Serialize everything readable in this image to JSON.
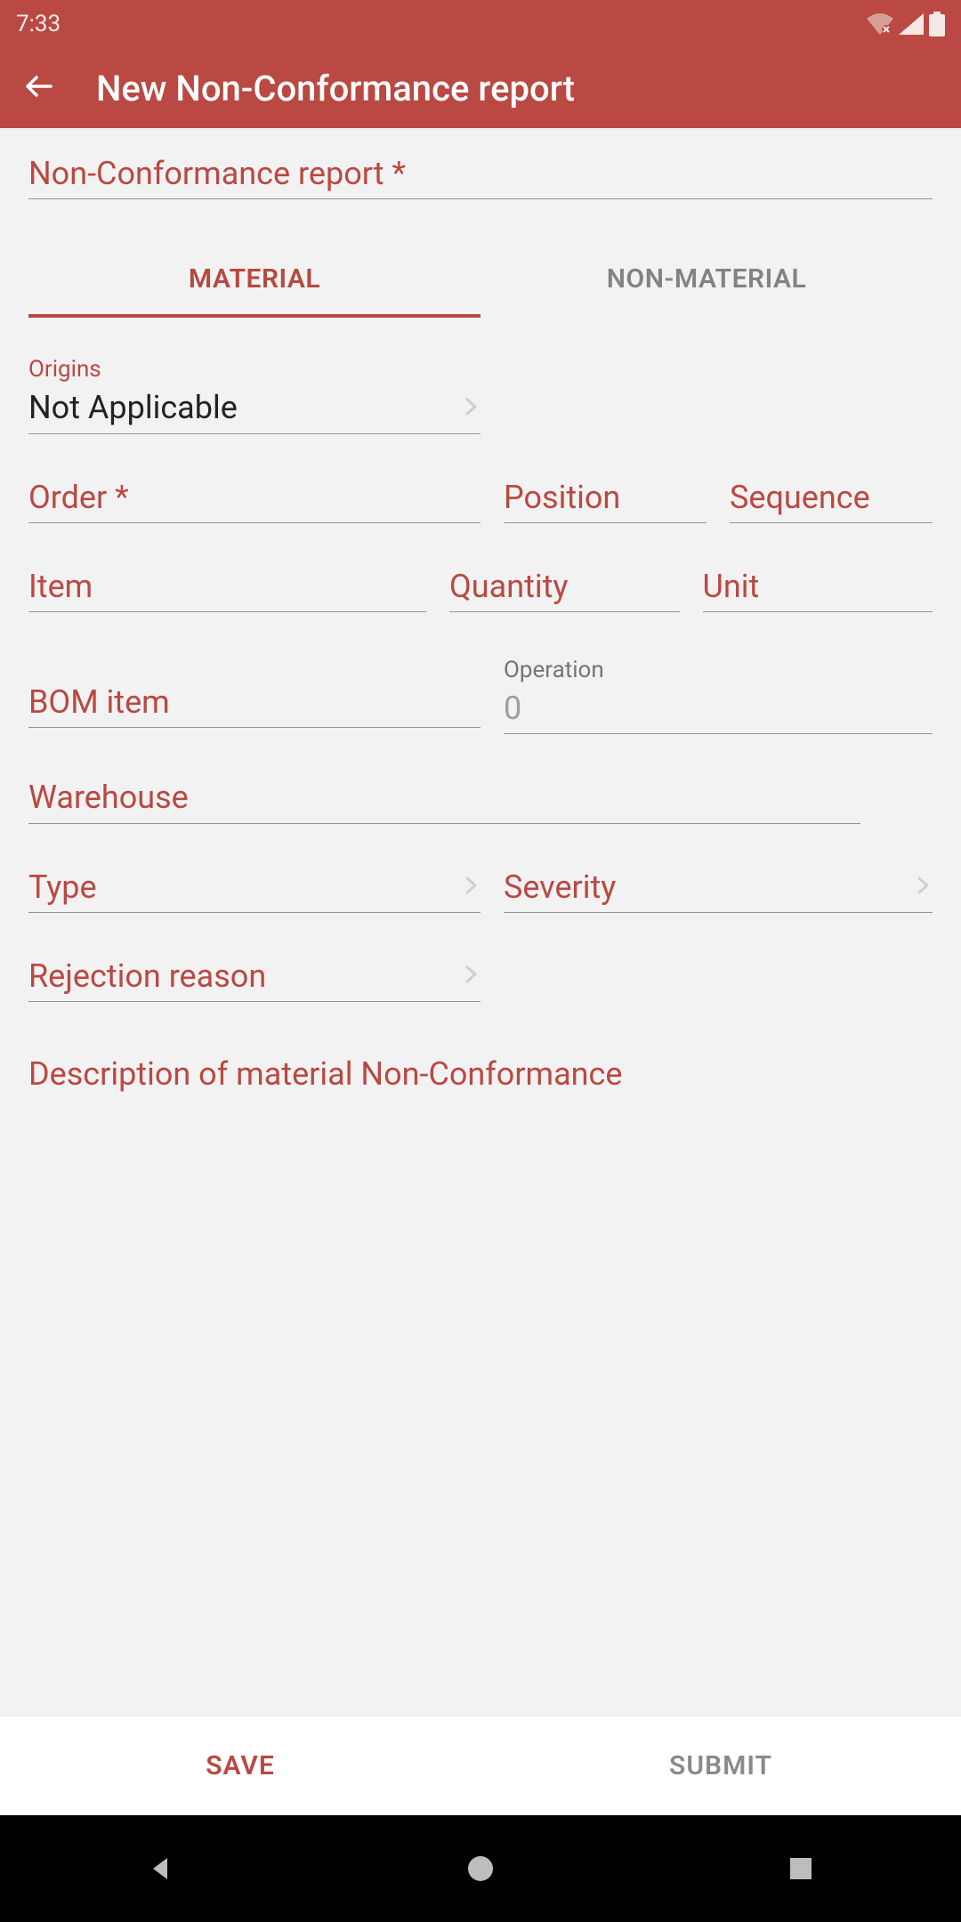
{
  "status": {
    "time": "7:33"
  },
  "header": {
    "title": "New Non-Conformance report"
  },
  "form": {
    "report_label": "Non-Conformance report *",
    "tabs": {
      "material": "MATERIAL",
      "non_material": "NON-MATERIAL"
    },
    "origins_label": "Origins",
    "origins_value": "Not Applicable",
    "order_label": "Order *",
    "position_label": "Position",
    "sequence_label": "Sequence",
    "item_label": "Item",
    "quantity_label": "Quantity",
    "unit_label": "Unit",
    "bom_label": "BOM item",
    "operation_label": "Operation",
    "operation_value": "0",
    "warehouse_label": "Warehouse",
    "type_label": "Type",
    "severity_label": "Severity",
    "rejection_label": "Rejection reason",
    "description_label": "Description of material Non-Conformance"
  },
  "footer": {
    "save": "SAVE",
    "submit": "SUBMIT"
  }
}
